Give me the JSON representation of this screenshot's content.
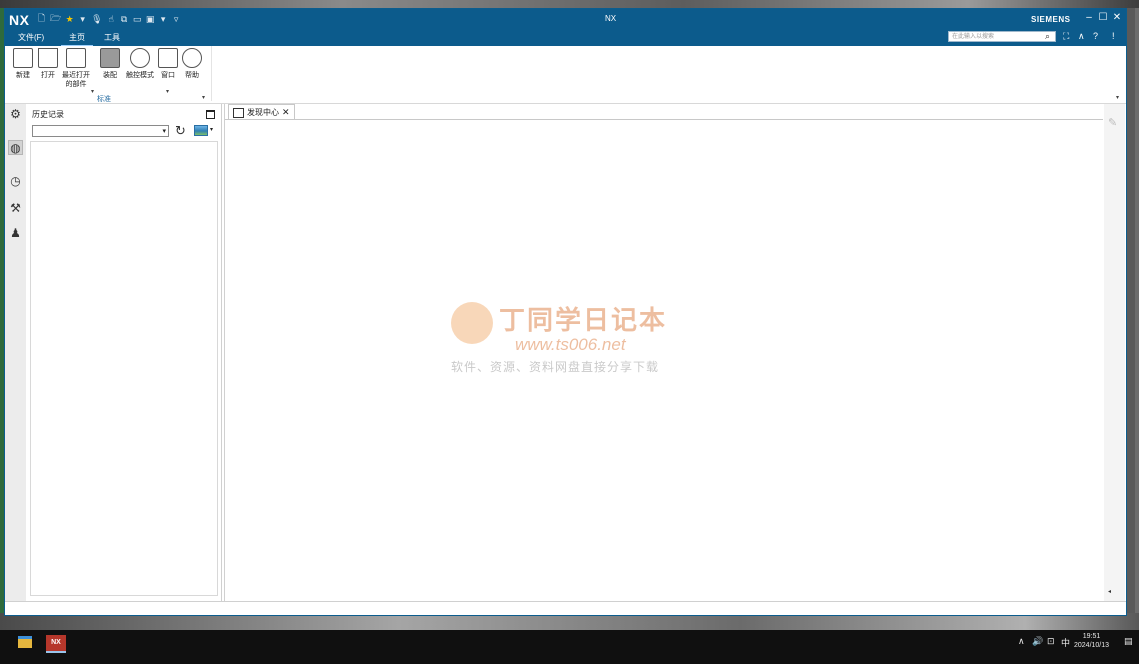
{
  "app": {
    "logo": "NX",
    "title": "NX",
    "brand": "SIEMENS",
    "accent_color": "#0c5b8c"
  },
  "quick_access": {
    "icons": [
      "new-file-icon",
      "open-folder-icon",
      "star-icon",
      "dropdown-icon",
      "microphone-icon",
      "touch-icon",
      "copy-windows-icon",
      "window-icon",
      "window-menu-icon",
      "dropdown-icon",
      "customize-icon"
    ]
  },
  "menu": {
    "tabs": [
      {
        "label": "文件(F)"
      },
      {
        "label": "主页"
      },
      {
        "label": "工具"
      }
    ],
    "active": "主页"
  },
  "search": {
    "placeholder": "在此输入以搜索"
  },
  "ribbon": {
    "buttons": [
      {
        "label": "新建",
        "icon": "new-document-icon"
      },
      {
        "label": "打开",
        "icon": "open-folder-icon"
      },
      {
        "label": "最近打开\n的部件",
        "icon": "recent-parts-icon"
      },
      {
        "label": "装配",
        "icon": "assembly-icon"
      },
      {
        "label": "触控模式",
        "icon": "touch-mode-icon"
      },
      {
        "label": "窗口",
        "icon": "window-icon"
      },
      {
        "label": "帮助",
        "icon": "help-icon"
      }
    ],
    "group_label": "标准"
  },
  "history_panel": {
    "title": "历史记录"
  },
  "main": {
    "tab_label": "发现中心"
  },
  "watermark": {
    "title": "丁同学日记本",
    "url": "www.ts006.net",
    "subtitle": "软件、资源、资料网盘直接分享下载"
  },
  "taskbar": {
    "time": "19:51",
    "date": "2024/10/13",
    "ime": "中",
    "nx_label": "NX"
  }
}
